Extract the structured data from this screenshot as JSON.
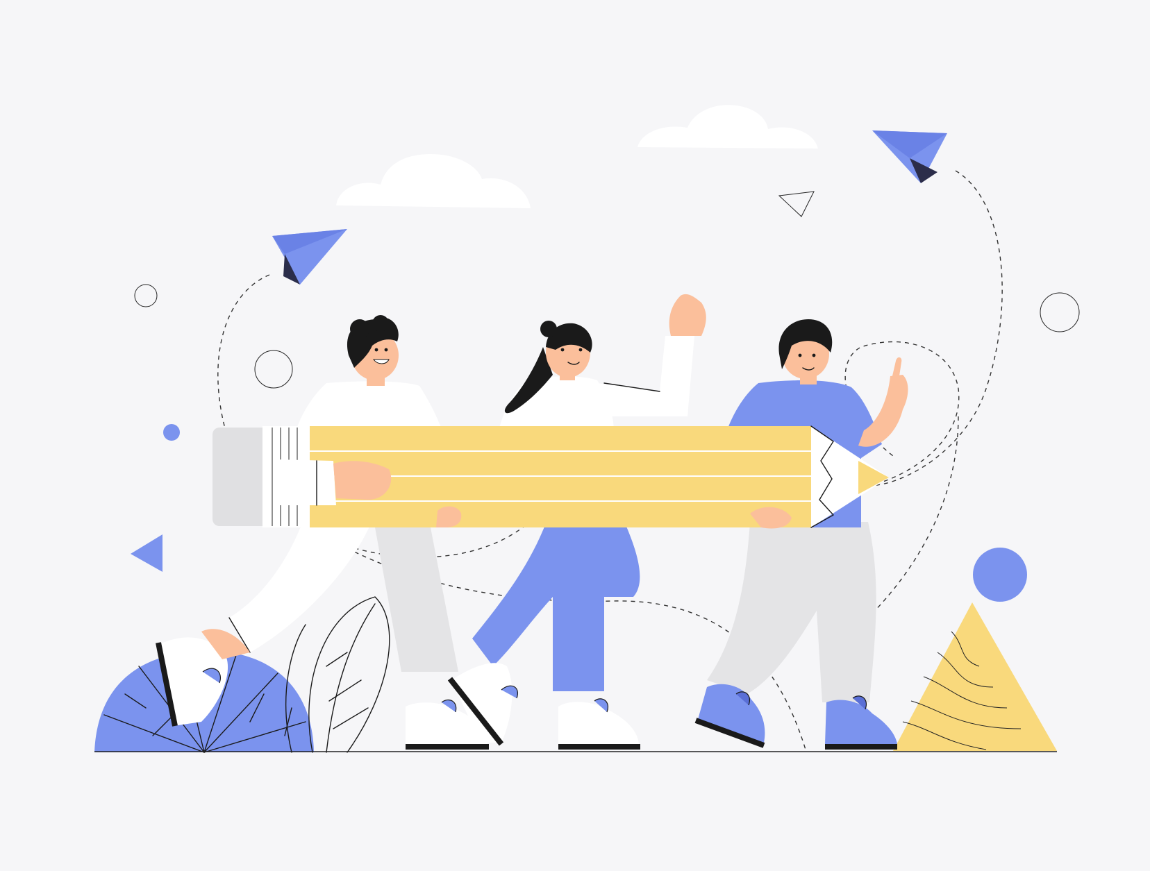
{
  "colors": {
    "background": "#f6f6f8",
    "accent_blue": "#7b93ee",
    "accent_blue_dark": "#5a6fd6",
    "pencil_yellow": "#f9d97c",
    "pencil_yellow_line": "#ffffff",
    "skin": "#fbbf9b",
    "hair": "#1a1a1a",
    "cloud": "#ffffff",
    "pants_gray": "#e4e4e6",
    "shirt_white": "#ffffff",
    "outline": "#1a1a1a"
  },
  "scene": {
    "description_icons": [
      "paper-plane-icon",
      "paper-plane-icon",
      "cloud-icon",
      "cloud-icon",
      "triangle-icon",
      "circle-icon",
      "pencil-icon"
    ]
  }
}
